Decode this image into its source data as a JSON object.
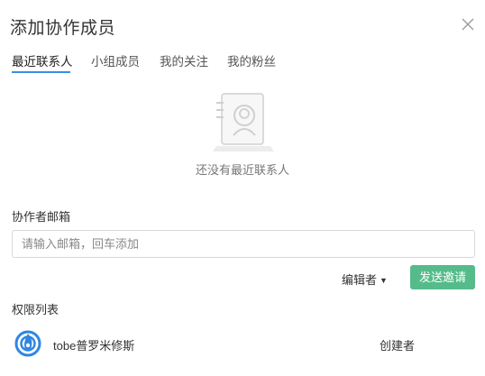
{
  "dialog": {
    "title": "添加协作成员",
    "close_icon": "close-icon"
  },
  "tabs": [
    {
      "label": "最近联系人",
      "active": true
    },
    {
      "label": "小组成员",
      "active": false
    },
    {
      "label": "我的关注",
      "active": false
    },
    {
      "label": "我的粉丝",
      "active": false
    }
  ],
  "empty_state": {
    "icon": "contact-card-icon",
    "text": "还没有最近联系人"
  },
  "email_section": {
    "label": "协作者邮箱",
    "placeholder": "请输入邮箱，回车添加",
    "value": ""
  },
  "role_select": {
    "selected": "编辑者",
    "caret": "▼"
  },
  "invite_button": {
    "label": "发送邀请",
    "color": "#55bb8a"
  },
  "permissions": {
    "label": "权限列表",
    "members": [
      {
        "name": "tobe普罗米修斯",
        "role": "创建者",
        "avatar_icon": "user-avatar"
      }
    ]
  },
  "colors": {
    "accent": "#3a8de6",
    "invite_green": "#55bb8a"
  }
}
